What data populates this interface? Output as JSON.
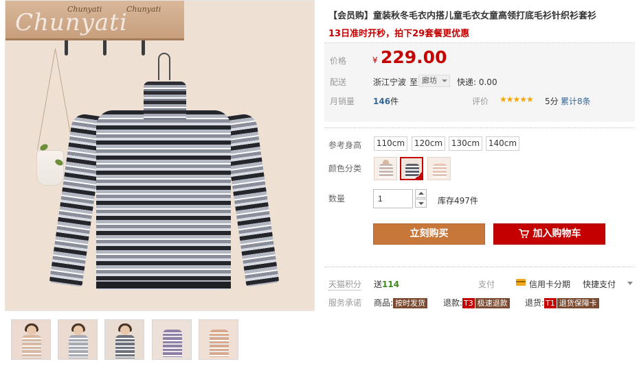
{
  "product": {
    "title": "【会员购】童装秋冬毛衣内搭儿童毛衣女童高领打底毛衫针织衫套衫",
    "promo": "13日准时开秒，拍下29套餐更优惠"
  },
  "brand": {
    "script": "Chunyati",
    "small1": "Chunyati",
    "small2": "Chunyati"
  },
  "price": {
    "label": "价格",
    "currency": "¥",
    "amount": "229.00"
  },
  "shipping": {
    "label": "配送",
    "from": "浙江宁波",
    "to_word": "至",
    "destination": "廊坊",
    "fee": "快递: 0.00"
  },
  "sales": {
    "label": "月销量",
    "count": "146",
    "unit": "件"
  },
  "rating": {
    "label": "评价",
    "stars": "★★★★★",
    "score": "5分",
    "reviews": "累计8条"
  },
  "sizes": {
    "label": "参考身高",
    "options": [
      "110cm",
      "120cm",
      "130cm",
      "140cm"
    ]
  },
  "colors": {
    "label": "颜色分类",
    "swatches": [
      "#c9b7b0",
      "#5b5f6a",
      "#e6c4b4"
    ]
  },
  "quantity": {
    "label": "数量",
    "value": "1",
    "stock": "库存497件"
  },
  "buttons": {
    "buy": "立刻购买",
    "cart": "加入购物车"
  },
  "points": {
    "label": "天猫积分",
    "prefix": "送",
    "value": "114"
  },
  "payment": {
    "label": "支付",
    "installment": "信用卡分期",
    "quick": "快捷支付"
  },
  "promise": {
    "label": "服务承诺",
    "goods_label": "商品:",
    "goods_tag": "按时发货",
    "refund_label": "退款:",
    "refund_code": "T3",
    "refund_tag": "极速退款",
    "return_label": "退货:",
    "return_code": "T1",
    "return_tag": "退货保障卡"
  },
  "thumbnails": [
    {
      "bg": "#ecd9cf",
      "body": "#d9b8a2"
    },
    {
      "bg": "#eadad0",
      "body": "#a7a9b3"
    },
    {
      "bg": "#e9dcd2",
      "body": "#6c717c"
    },
    {
      "bg": "#ece0d8",
      "body": "#8f7ea5"
    },
    {
      "bg": "#efdfd5",
      "body": "#d9a98e"
    }
  ],
  "colors_theme": {
    "accent": "#c40000",
    "buy_button": "#c8773b",
    "link": "#336699"
  }
}
